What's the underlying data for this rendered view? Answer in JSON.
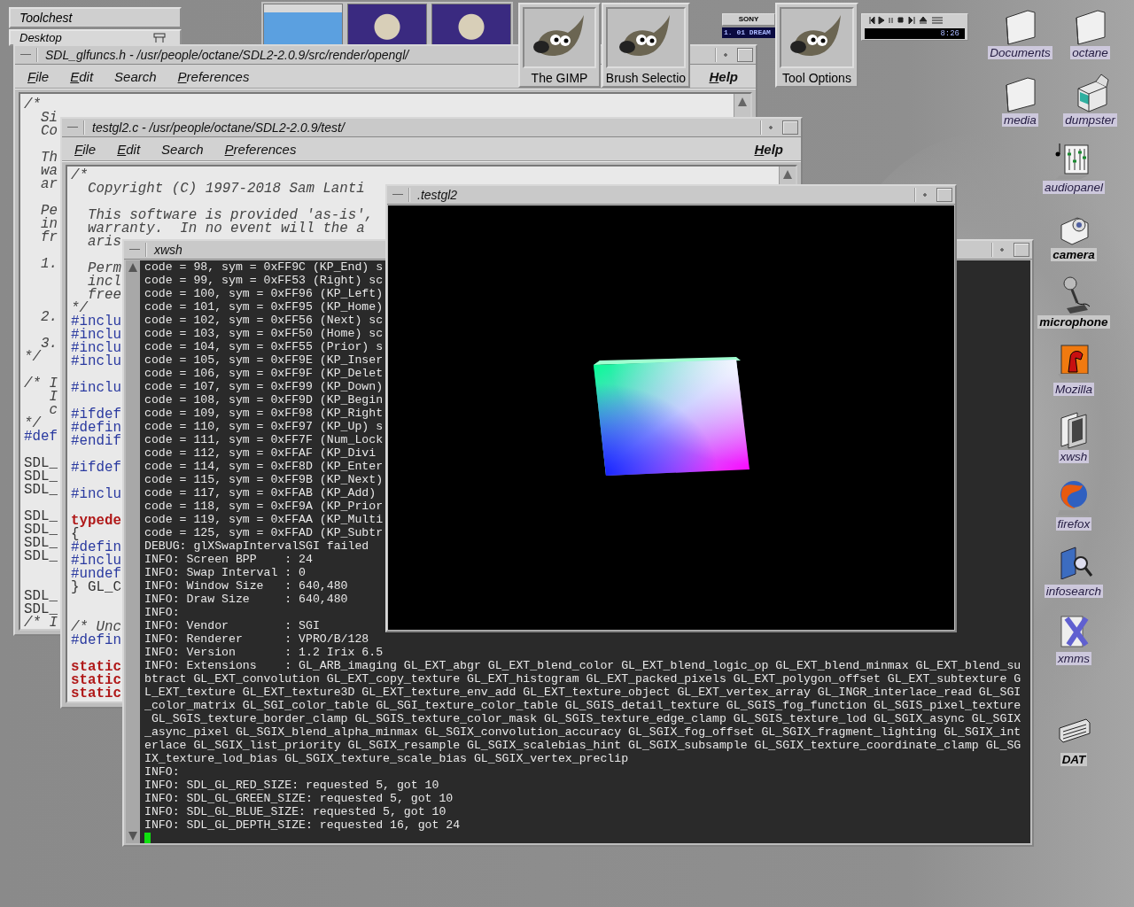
{
  "toolchest": {
    "title": "Toolchest",
    "menu_label": "Desktop"
  },
  "cd_player": {
    "brand": "SONY",
    "track": "1. 01 DREAM"
  },
  "media_player": {
    "time": "8:26"
  },
  "gimp_dialogs": [
    {
      "label": "The GIMP"
    },
    {
      "label": "Brush Selectio"
    },
    {
      "label": "Tool Options"
    }
  ],
  "header_editor": {
    "title": "SDL_glfuncs.h - /usr/people/octane/SDL2-2.0.9/src/render/opengl/",
    "menus": [
      {
        "label": "File",
        "mnemonic": true
      },
      {
        "label": "Edit",
        "mnemonic": true
      },
      {
        "label": "Search",
        "mnemonic": false
      },
      {
        "label": "Preferences",
        "mnemonic": true
      }
    ],
    "help": "Help",
    "lines": [
      {
        "kind": "comment",
        "text": "/*"
      },
      {
        "kind": "comment",
        "text": "  Si"
      },
      {
        "kind": "comment",
        "text": "  Co"
      },
      {
        "kind": "blank"
      },
      {
        "kind": "comment",
        "text": "  Th"
      },
      {
        "kind": "comment",
        "text": "  wa"
      },
      {
        "kind": "comment",
        "text": "  ar"
      },
      {
        "kind": "blank"
      },
      {
        "kind": "comment",
        "text": "  Pe"
      },
      {
        "kind": "comment",
        "text": "  in"
      },
      {
        "kind": "comment",
        "text": "  fr"
      },
      {
        "kind": "blank"
      },
      {
        "kind": "comment",
        "text": "  1."
      },
      {
        "kind": "blank"
      },
      {
        "kind": "blank"
      },
      {
        "kind": "blank"
      },
      {
        "kind": "comment",
        "text": "  2."
      },
      {
        "kind": "blank"
      },
      {
        "kind": "comment",
        "text": "  3."
      },
      {
        "kind": "comment",
        "text": "*/"
      },
      {
        "kind": "blank"
      },
      {
        "kind": "comment",
        "text": "/* I"
      },
      {
        "kind": "comment",
        "text": "   I"
      },
      {
        "kind": "comment",
        "text": "   c"
      },
      {
        "kind": "comment",
        "text": "*/"
      },
      {
        "kind": "directive",
        "text": "#def"
      },
      {
        "kind": "blank"
      },
      {
        "kind": "plain",
        "text": "SDL_"
      },
      {
        "kind": "plain",
        "text": "SDL_"
      },
      {
        "kind": "plain",
        "text": "SDL_"
      },
      {
        "kind": "blank"
      },
      {
        "kind": "plain",
        "text": "SDL_"
      },
      {
        "kind": "plain",
        "text": "SDL_"
      },
      {
        "kind": "plain",
        "text": "SDL_"
      },
      {
        "kind": "plain",
        "text": "SDL_"
      },
      {
        "kind": "blank"
      },
      {
        "kind": "blank"
      },
      {
        "kind": "plain",
        "text": "SDL_"
      },
      {
        "kind": "plain",
        "text": "SDL_"
      },
      {
        "kind": "comment",
        "text": "/* I"
      }
    ]
  },
  "source_editor": {
    "title": "testgl2.c - /usr/people/octane/SDL2-2.0.9/test/",
    "menus": [
      {
        "label": "File",
        "mnemonic": true
      },
      {
        "label": "Edit",
        "mnemonic": true
      },
      {
        "label": "Search",
        "mnemonic": false
      },
      {
        "label": "Preferences",
        "mnemonic": true
      }
    ],
    "help": "Help",
    "lines": [
      {
        "kind": "comment",
        "text": "/*"
      },
      {
        "kind": "comment",
        "text": "  Copyright (C) 1997-2018 Sam Lanti"
      },
      {
        "kind": "blank"
      },
      {
        "kind": "comment",
        "text": "  This software is provided 'as-is',"
      },
      {
        "kind": "comment",
        "text": "  warranty.  In no event will the a"
      },
      {
        "kind": "comment",
        "text": "  aris"
      },
      {
        "kind": "blank"
      },
      {
        "kind": "comment",
        "text": "  Perm"
      },
      {
        "kind": "comment",
        "text": "  incl"
      },
      {
        "kind": "comment",
        "text": "  free"
      },
      {
        "kind": "comment",
        "text": "*/"
      },
      {
        "kind": "directive",
        "text": "#inclu"
      },
      {
        "kind": "directive",
        "text": "#inclu"
      },
      {
        "kind": "directive",
        "text": "#inclu"
      },
      {
        "kind": "directive",
        "text": "#inclu"
      },
      {
        "kind": "blank"
      },
      {
        "kind": "directive",
        "text": "#inclu"
      },
      {
        "kind": "blank"
      },
      {
        "kind": "directive",
        "text": "#ifdef"
      },
      {
        "kind": "directive",
        "text": "#defin"
      },
      {
        "kind": "directive",
        "text": "#endif"
      },
      {
        "kind": "blank"
      },
      {
        "kind": "directive",
        "text": "#ifdef"
      },
      {
        "kind": "blank"
      },
      {
        "kind": "directive",
        "text": "#inclu"
      },
      {
        "kind": "blank"
      },
      {
        "kind": "keyword",
        "text": "typede"
      },
      {
        "kind": "plain",
        "text": "{"
      },
      {
        "kind": "directive",
        "text": "#defin"
      },
      {
        "kind": "directive",
        "text": "#inclu"
      },
      {
        "kind": "directive",
        "text": "#undef"
      },
      {
        "kind": "plain",
        "text": "} GL_C"
      },
      {
        "kind": "blank"
      },
      {
        "kind": "blank"
      },
      {
        "kind": "comment",
        "text": "/* Unc"
      },
      {
        "kind": "directive",
        "text": "#defin"
      },
      {
        "kind": "blank"
      },
      {
        "kind": "keyword",
        "text": "static"
      },
      {
        "kind": "keyword",
        "text": "static"
      },
      {
        "kind": "keyword",
        "text": "static"
      }
    ]
  },
  "terminal": {
    "title": "xwsh",
    "cursor": true,
    "lines": [
      "code = 98, sym = 0xFF9C (KP_End) s",
      "code = 99, sym = 0xFF53 (Right) sc",
      "code = 100, sym = 0xFF96 (KP_Left)",
      "code = 101, sym = 0xFF95 (KP_Home)",
      "code = 102, sym = 0xFF56 (Next) sc",
      "code = 103, sym = 0xFF50 (Home) sc",
      "code = 104, sym = 0xFF55 (Prior) s",
      "code = 105, sym = 0xFF9E (KP_Inser",
      "code = 106, sym = 0xFF9F (KP_Delet",
      "code = 107, sym = 0xFF99 (KP_Down)",
      "code = 108, sym = 0xFF9D (KP_Begin",
      "code = 109, sym = 0xFF98 (KP_Right",
      "code = 110, sym = 0xFF97 (KP_Up) s",
      "code = 111, sym = 0xFF7F (Num_Lock",
      "code = 112, sym = 0xFFAF (KP_Divi",
      "code = 114, sym = 0xFF8D (KP_Enter",
      "code = 115, sym = 0xFF9B (KP_Next)",
      "code = 117, sym = 0xFFAB (KP_Add)",
      "code = 118, sym = 0xFF9A (KP_Prior",
      "code = 119, sym = 0xFFAA (KP_Multi",
      "code = 125, sym = 0xFFAD (KP_Subtr",
      "DEBUG: glXSwapIntervalSGI failed",
      "INFO: Screen BPP    : 24",
      "INFO: Swap Interval : 0",
      "INFO: Window Size   : 640,480",
      "INFO: Draw Size     : 640,480",
      "INFO:",
      "INFO: Vendor        : SGI",
      "INFO: Renderer      : VPRO/B/128",
      "INFO: Version       : 1.2 Irix 6.5",
      "INFO: Extensions    : GL_ARB_imaging GL_EXT_abgr GL_EXT_blend_color GL_EXT_blend_logic_op GL_EXT_blend_minmax GL_EXT_blend_su",
      "btract GL_EXT_convolution GL_EXT_copy_texture GL_EXT_histogram GL_EXT_packed_pixels GL_EXT_polygon_offset GL_EXT_subtexture G",
      "L_EXT_texture GL_EXT_texture3D GL_EXT_texture_env_add GL_EXT_texture_object GL_EXT_vertex_array GL_INGR_interlace_read GL_SGI",
      "_color_matrix GL_SGI_color_table GL_SGI_texture_color_table GL_SGIS_detail_texture GL_SGIS_fog_function GL_SGIS_pixel_texture",
      " GL_SGIS_texture_border_clamp GL_SGIS_texture_color_mask GL_SGIS_texture_edge_clamp GL_SGIS_texture_lod GL_SGIX_async GL_SGIX",
      "_async_pixel GL_SGIX_blend_alpha_minmax GL_SGIX_convolution_accuracy GL_SGIX_fog_offset GL_SGIX_fragment_lighting GL_SGIX_int",
      "erlace GL_SGIX_list_priority GL_SGIX_resample GL_SGIX_scalebias_hint GL_SGIX_subsample GL_SGIX_texture_coordinate_clamp GL_SG",
      "IX_texture_lod_bias GL_SGIX_texture_scale_bias GL_SGIX_vertex_preclip",
      "INFO:",
      "INFO: SDL_GL_RED_SIZE: requested 5, got 10",
      "INFO: SDL_GL_GREEN_SIZE: requested 5, got 10",
      "INFO: SDL_GL_BLUE_SIZE: requested 5, got 10",
      "INFO: SDL_GL_DEPTH_SIZE: requested 16, got 24"
    ]
  },
  "gl_window": {
    "title": ".testgl2"
  },
  "desktop_icons": [
    {
      "kind": "folder",
      "label": "Documents",
      "bold": false
    },
    {
      "kind": "folder",
      "label": "octane",
      "bold": false
    },
    {
      "kind": "folder",
      "label": "media",
      "bold": false
    },
    {
      "kind": "bin",
      "label": "dumpster",
      "bold": false
    },
    {
      "kind": "sliders",
      "label": "audiopanel",
      "bold": false
    },
    {
      "kind": "camera",
      "label": "camera",
      "bold": true
    },
    {
      "kind": "microphone",
      "label": "microphone",
      "bold": true
    },
    {
      "kind": "dinosaur",
      "label": "Mozilla",
      "bold": false
    },
    {
      "kind": "pages",
      "label": "xwsh",
      "bold": false
    },
    {
      "kind": "globe",
      "label": "firefox",
      "bold": false
    },
    {
      "kind": "book",
      "label": "infosearch",
      "bold": false
    },
    {
      "kind": "cross",
      "label": "xmms",
      "bold": false
    },
    {
      "kind": "tape",
      "label": "DAT",
      "bold": true
    }
  ]
}
